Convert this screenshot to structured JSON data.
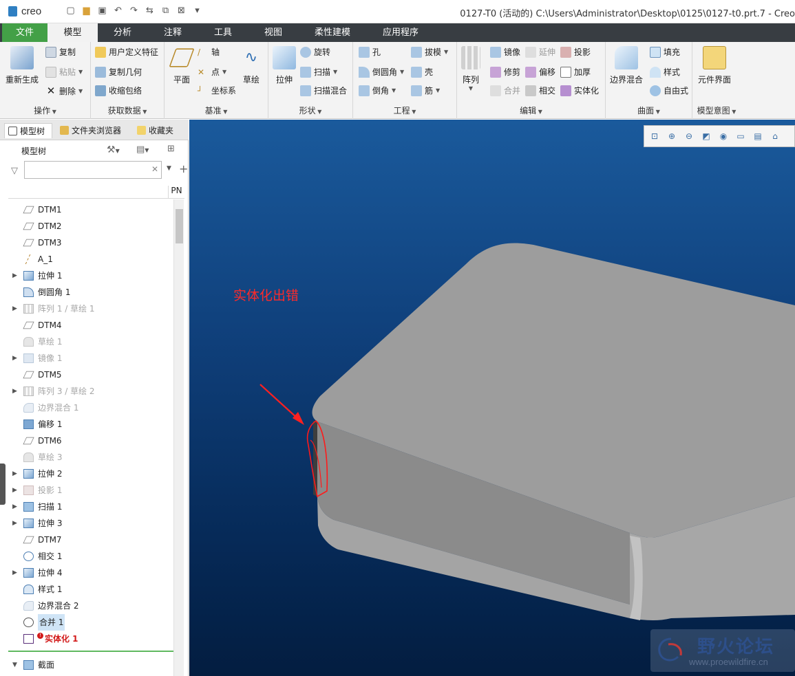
{
  "app": {
    "logo": "creo",
    "window_title": "0127-T0 (活动的) C:\\Users\\Administrator\\Desktop\\0125\\0127-t0.prt.7 - Creo"
  },
  "tabs": [
    "文件",
    "模型",
    "分析",
    "注释",
    "工具",
    "视图",
    "柔性建模",
    "应用程序"
  ],
  "ribbon": {
    "operations": {
      "label": "操作",
      "regenerate": "重新生成",
      "copy": "复制",
      "paste": "粘贴",
      "delete": "删除"
    },
    "getdata": {
      "label": "获取数据",
      "udf": "用户定义特征",
      "copygeom": "复制几何",
      "shrinkwrap": "收缩包络"
    },
    "datum": {
      "label": "基准",
      "plane": "平面",
      "axis": "轴",
      "point": "点",
      "csys": "坐标系",
      "sketch": "草绘"
    },
    "shapes": {
      "label": "形状",
      "extrude": "拉伸",
      "revolve": "旋转",
      "sweep": "扫描",
      "sweptblend": "扫描混合"
    },
    "engineering": {
      "label": "工程",
      "hole": "孔",
      "draft": "拔模",
      "round": "倒圆角",
      "shell": "壳",
      "chamfer": "倒角",
      "rib": "筋"
    },
    "editing": {
      "label": "编辑",
      "pattern": "阵列",
      "mirror": "镜像",
      "extend": "延伸",
      "project": "投影",
      "trim": "修剪",
      "offset": "偏移",
      "thicken": "加厚",
      "merge": "合并",
      "intersect": "相交",
      "solidify": "实体化"
    },
    "surfaces": {
      "label": "曲面",
      "boundary": "边界混合",
      "fill": "填充",
      "style": "样式",
      "freestyle": "自由式"
    },
    "intent": {
      "label": "模型意图",
      "component": "元件界面"
    }
  },
  "leftpanel": {
    "tabs": [
      "模型树",
      "文件夹浏览器",
      "收藏夹"
    ],
    "tree_title": "模型树",
    "filter_placeholder": "",
    "col_pn": "PN",
    "items": [
      {
        "label": "DTM1",
        "icon": "datum-plane",
        "expand": false,
        "state": "normal"
      },
      {
        "label": "DTM2",
        "icon": "datum-plane",
        "expand": false,
        "state": "normal"
      },
      {
        "label": "DTM3",
        "icon": "datum-plane",
        "expand": false,
        "state": "normal"
      },
      {
        "label": "A_1",
        "icon": "datum-axis",
        "expand": false,
        "state": "normal"
      },
      {
        "label": "拉伸 1",
        "icon": "extrude",
        "expand": true,
        "state": "normal"
      },
      {
        "label": "倒圆角 1",
        "icon": "round",
        "expand": false,
        "state": "normal"
      },
      {
        "label": "阵列 1 / 草绘 1",
        "icon": "pattern",
        "expand": true,
        "state": "suppressed"
      },
      {
        "label": "DTM4",
        "icon": "datum-plane",
        "expand": false,
        "state": "normal"
      },
      {
        "label": "草绘 1",
        "icon": "sketch",
        "expand": false,
        "state": "suppressed"
      },
      {
        "label": "镜像 1",
        "icon": "mirror",
        "expand": true,
        "state": "suppressed"
      },
      {
        "label": "DTM5",
        "icon": "datum-plane",
        "expand": false,
        "state": "normal"
      },
      {
        "label": "阵列 3 / 草绘 2",
        "icon": "pattern",
        "expand": true,
        "state": "suppressed"
      },
      {
        "label": "边界混合 1",
        "icon": "boundary",
        "expand": false,
        "state": "suppressed"
      },
      {
        "label": "偏移 1",
        "icon": "offset",
        "expand": false,
        "state": "normal"
      },
      {
        "label": "DTM6",
        "icon": "datum-plane",
        "expand": false,
        "state": "normal"
      },
      {
        "label": "草绘 3",
        "icon": "sketch",
        "expand": false,
        "state": "suppressed"
      },
      {
        "label": "拉伸 2",
        "icon": "extrude",
        "expand": true,
        "state": "normal"
      },
      {
        "label": "投影 1",
        "icon": "project",
        "expand": true,
        "state": "suppressed"
      },
      {
        "label": "扫描 1",
        "icon": "sweep",
        "expand": true,
        "state": "normal"
      },
      {
        "label": "拉伸 3",
        "icon": "extrude",
        "expand": true,
        "state": "normal"
      },
      {
        "label": "DTM7",
        "icon": "datum-plane",
        "expand": false,
        "state": "normal"
      },
      {
        "label": "相交 1",
        "icon": "intersect",
        "expand": false,
        "state": "normal"
      },
      {
        "label": "拉伸 4",
        "icon": "extrude",
        "expand": true,
        "state": "normal"
      },
      {
        "label": "样式 1",
        "icon": "style",
        "expand": false,
        "state": "normal"
      },
      {
        "label": "边界混合 2",
        "icon": "boundary",
        "expand": false,
        "state": "normal"
      },
      {
        "label": "合并 1",
        "icon": "merge",
        "expand": false,
        "state": "selected"
      },
      {
        "label": "实体化 1",
        "icon": "solidify",
        "expand": false,
        "state": "error"
      }
    ],
    "section": "截面"
  },
  "viewport": {
    "annotation": "实体化出错",
    "watermark_cn": "野火论坛",
    "watermark_url": "www.proewildfire.cn"
  }
}
